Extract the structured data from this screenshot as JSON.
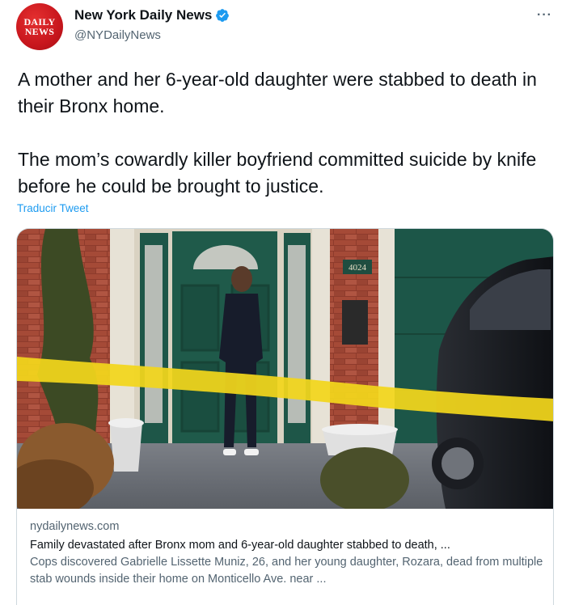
{
  "author": {
    "avatar_text_line1": "DAILY",
    "avatar_text_line2": "NEWS",
    "display_name": "New York Daily News",
    "handle": "@NYDailyNews",
    "verified_icon": "verified-badge-icon",
    "more_icon": "more-options-icon"
  },
  "tweet": {
    "paragraph1": "A mother and her 6-year-old daughter were stabbed to death in their Bronx home.",
    "paragraph2": "The mom’s cowardly killer boyfriend committed suicide by knife before he could be brought to justice.",
    "translate_label": "Traducir Tweet"
  },
  "link_card": {
    "image_house_number": "4024",
    "domain": "nydailynews.com",
    "title": "Family devastated after Bronx mom and 6-year-old daughter stabbed to death, ...",
    "description": "Cops discovered Gabrielle Lissette Muniz, 26, and her young daughter, Rozara, dead from multiple stab wounds inside their home on Monticello Ave. near ..."
  },
  "colors": {
    "accent_link": "#1d9bf0",
    "brand_red": "#c8161d",
    "door_green": "#1f5a4a",
    "tape_yellow": "#f2d61c"
  }
}
